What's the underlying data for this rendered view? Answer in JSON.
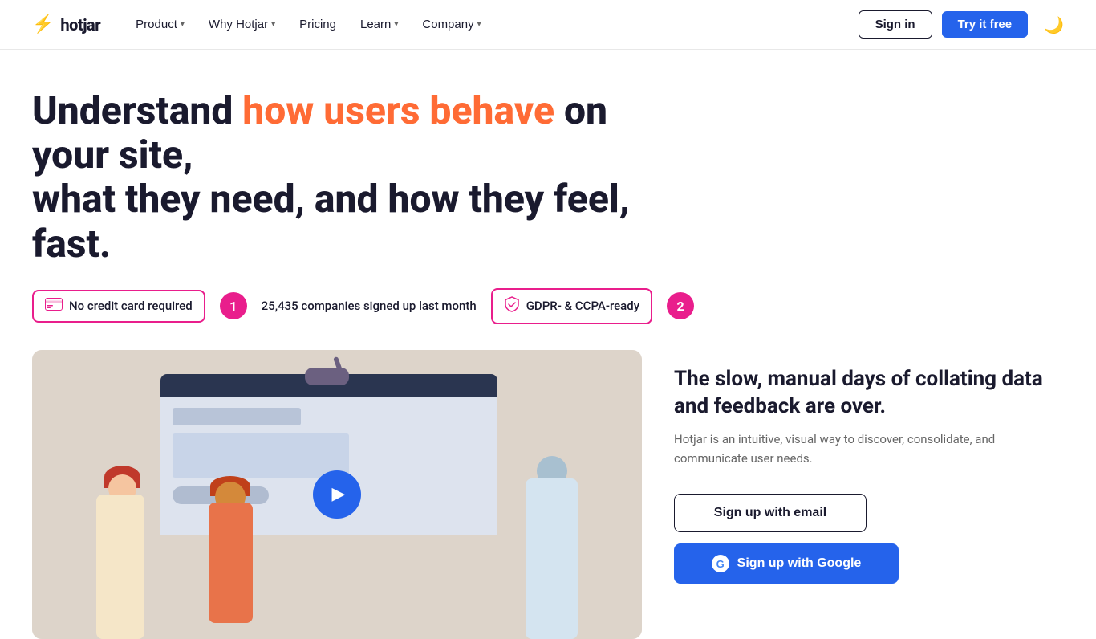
{
  "nav": {
    "logo_text": "hotjar",
    "logo_icon": "⚡",
    "links": [
      {
        "id": "product",
        "label": "Product",
        "has_dropdown": true
      },
      {
        "id": "why-hotjar",
        "label": "Why Hotjar",
        "has_dropdown": true
      },
      {
        "id": "pricing",
        "label": "Pricing",
        "has_dropdown": false
      },
      {
        "id": "learn",
        "label": "Learn",
        "has_dropdown": true
      },
      {
        "id": "company",
        "label": "Company",
        "has_dropdown": true
      }
    ],
    "signin_label": "Sign in",
    "try_label": "Try it free",
    "dark_mode_icon": "🌙"
  },
  "hero": {
    "headline_plain": "Understand ",
    "headline_highlight": "how users behave",
    "headline_suffix": " on your site, what they need, and how they feel, fast."
  },
  "badges": [
    {
      "id": "no-credit-card",
      "icon": "💳",
      "label": "No credit card required",
      "type": "outlined"
    },
    {
      "id": "companies-count",
      "number": "1",
      "label": "25,435 companies signed up last month",
      "type": "number"
    },
    {
      "id": "gdpr",
      "icon": "🛡",
      "label": "GDPR- & CCPA-ready",
      "type": "outlined"
    },
    {
      "id": "gdpr-number",
      "number": "2",
      "label": "",
      "type": "number-standalone"
    }
  ],
  "right": {
    "headline": "The slow, manual days of collating data and feedback are over.",
    "subtext": "Hotjar is an intuitive, visual way to discover, consolidate, and communicate user needs.",
    "signup_email_label": "Sign up with email",
    "signup_google_label": "Sign up with Google"
  }
}
